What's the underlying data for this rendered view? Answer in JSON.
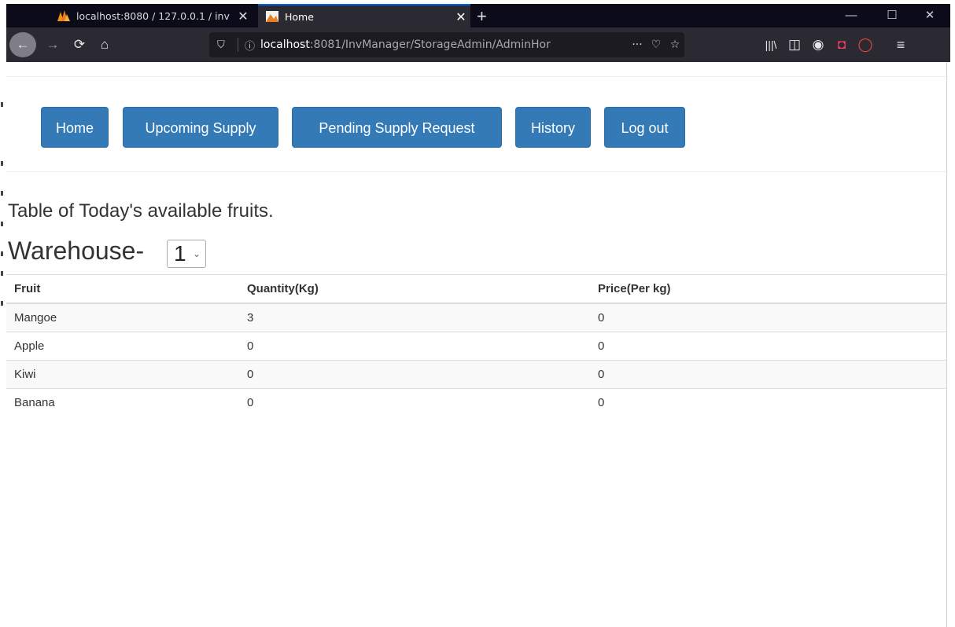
{
  "browser": {
    "tabs": [
      {
        "title": "localhost:8080 / 127.0.0.1 / inv",
        "close": "✕",
        "active": false
      },
      {
        "title": "Home",
        "close": "✕",
        "active": true
      }
    ],
    "new_tab": "+",
    "window_controls": {
      "minimize": "—",
      "maximize": "☐",
      "close": "✕"
    },
    "url_host": "localhost",
    "url_rest": ":8081/InvManager/StorageAdmin/AdminHor",
    "toolbar_icons": [
      "library-icon",
      "sidebar-icon",
      "account-icon",
      "pocket-icon",
      "extension-icon",
      "menu-icon"
    ]
  },
  "nav": {
    "buttons": [
      "Home",
      "Upcoming Supply",
      "Pending Supply Request",
      "History",
      "Log out"
    ]
  },
  "main": {
    "heading": "Table of Today's available fruits.",
    "warehouse_label": "Warehouse-",
    "warehouse_value": "1"
  },
  "table": {
    "headers": [
      "Fruit",
      "Quantity(Kg)",
      "Price(Per kg)"
    ],
    "rows": [
      [
        "Mangoe",
        "3",
        "0"
      ],
      [
        "Apple",
        "0",
        "0"
      ],
      [
        "Kiwi",
        "0",
        "0"
      ],
      [
        "Banana",
        "0",
        "0"
      ]
    ]
  },
  "colors": {
    "button_bg": "#337ab7",
    "chrome_dark": "#0b0b1a",
    "toolbar": "#2b2a33"
  }
}
